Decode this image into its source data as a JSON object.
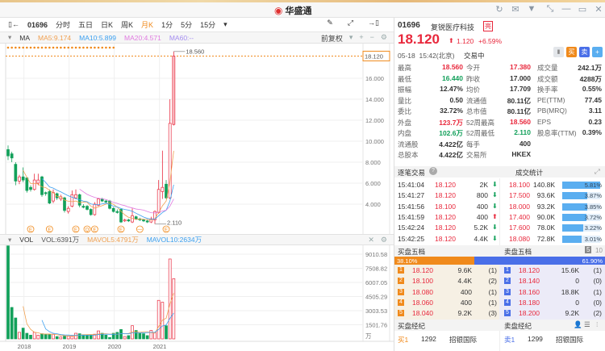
{
  "app": {
    "title": "华盛通",
    "window_icons": [
      "refresh-icon",
      "mail-icon",
      "shirt-icon",
      "shrink-icon",
      "minimize-icon",
      "maximize-icon",
      "close-icon"
    ]
  },
  "toolbar": {
    "code": "01696",
    "tabs": [
      "分时",
      "五日",
      "日K",
      "周K",
      "月K",
      "1分",
      "5分",
      "15分"
    ],
    "active": "月K"
  },
  "ma_row": {
    "label": "MA",
    "ma5": "MA5:9.174",
    "ma10": "MA10:5.899",
    "ma20": "MA20:4.571",
    "ma60": "MA60:--",
    "adjust": "前复权"
  },
  "vol_row": {
    "label": "VOL",
    "vol": "VOL:6391万",
    "mavol5": "MAVOL5:4791万",
    "mavol10": "MAVOL10:2634万"
  },
  "colors": {
    "up": "#e8283c",
    "down": "#12a05a",
    "ma5": "#f0a050",
    "ma10": "#3ba0f0",
    "ma20": "#e07be0",
    "accent": "#f08a1c"
  },
  "chart_data": {
    "type": "candlestick",
    "period": "monthly",
    "start": "2017-09",
    "ohlc": [
      [
        9.2,
        9.6,
        8.2,
        8.6
      ],
      [
        8.8,
        9.0,
        8.0,
        8.4
      ],
      [
        7.8,
        8.0,
        5.8,
        6.2
      ],
      [
        6.2,
        6.8,
        5.9,
        6.6
      ],
      [
        6.6,
        7.5,
        6.1,
        6.3
      ],
      [
        6.5,
        6.6,
        5.1,
        5.3
      ],
      [
        5.6,
        5.8,
        5.2,
        5.4
      ],
      [
        5.4,
        6.9,
        5.3,
        6.3
      ],
      [
        6.0,
        6.9,
        5.8,
        6.3
      ],
      [
        6.6,
        6.7,
        4.7,
        4.9
      ],
      [
        5.1,
        5.2,
        4.8,
        5.0
      ],
      [
        5.2,
        5.4,
        4.0,
        4.1
      ],
      [
        4.3,
        5.4,
        4.1,
        5.1
      ],
      [
        5.0,
        5.1,
        4.4,
        4.6
      ],
      [
        4.5,
        4.9,
        4.3,
        4.7
      ],
      [
        4.6,
        4.7,
        3.2,
        3.4
      ],
      [
        3.3,
        3.8,
        3.1,
        3.6
      ],
      [
        3.8,
        5.3,
        3.7,
        4.9
      ],
      [
        4.6,
        5.4,
        4.5,
        4.9
      ],
      [
        4.9,
        5.0,
        3.7,
        3.9
      ],
      [
        3.8,
        4.0,
        3.6,
        3.7
      ],
      [
        3.8,
        3.9,
        3.4,
        3.5
      ],
      [
        3.5,
        3.6,
        2.9,
        3.0
      ],
      [
        3.0,
        4.2,
        2.9,
        4.0
      ],
      [
        3.9,
        4.6,
        3.8,
        4.5
      ],
      [
        4.5,
        4.6,
        4.2,
        4.3
      ],
      [
        4.3,
        4.4,
        4.1,
        4.2
      ],
      [
        4.3,
        4.4,
        3.5,
        3.6
      ],
      [
        3.6,
        3.7,
        3.2,
        3.3
      ],
      [
        3.3,
        3.5,
        3.1,
        3.2
      ],
      [
        3.5,
        3.6,
        2.2,
        2.3
      ],
      [
        2.4,
        2.6,
        2.3,
        2.5
      ],
      [
        2.5,
        2.6,
        2.3,
        2.4
      ],
      [
        2.3,
        3.6,
        2.2,
        2.9
      ],
      [
        2.8,
        2.9,
        2.5,
        2.6
      ],
      [
        2.6,
        2.7,
        2.4,
        2.5
      ],
      [
        2.5,
        2.6,
        2.3,
        2.4
      ],
      [
        2.4,
        2.5,
        2.2,
        2.3
      ],
      [
        2.3,
        2.8,
        2.2,
        2.6
      ],
      [
        2.5,
        3.4,
        2.11,
        3.3
      ],
      [
        3.2,
        6.3,
        3.1,
        5.4
      ],
      [
        5.2,
        9.1,
        4.5,
        5.6
      ],
      [
        5.9,
        6.3,
        4.5,
        4.6
      ],
      [
        4.6,
        14.0,
        4.5,
        11.7
      ],
      [
        11.6,
        18.56,
        11.5,
        18.12
      ]
    ],
    "volume": [
      9900,
      3350,
      2230,
      700,
      1150,
      600,
      400,
      700,
      400,
      550,
      500,
      450,
      500,
      250,
      200,
      300,
      300,
      300,
      600,
      550,
      450,
      400,
      400,
      500,
      850,
      600,
      400,
      150,
      600,
      700,
      1000,
      250,
      350,
      1400,
      900,
      600,
      550,
      350,
      900,
      700,
      4100,
      3900,
      1400,
      8500,
      6400
    ],
    "price_axis": [
      "16.000",
      "14.000",
      "12.000",
      "10.000",
      "8.000",
      "6.000",
      "4.000"
    ],
    "price_ticks": [
      16,
      14,
      12,
      10,
      8,
      6,
      4
    ],
    "current_price": "18.120",
    "high_label": "18.560",
    "low_label": "2.110",
    "high_value": 18.56,
    "low_value": 2.11,
    "volume_axis": [
      "9010.58",
      "7508.82",
      "6007.05",
      "4505.29",
      "3003.53",
      "1501.76"
    ],
    "volume_ticks": [
      9010.58,
      7508.82,
      6007.05,
      4505.29,
      3003.53,
      1501.76
    ],
    "volume_unit": "万",
    "x_labels": [
      "2018",
      "2019",
      "2020",
      "2021"
    ],
    "x_label_index": [
      4,
      16,
      28,
      40
    ],
    "events": [
      {
        "index": 6,
        "glyph": "E"
      },
      {
        "index": 11,
        "glyph": "E"
      },
      {
        "index": 18,
        "glyph": "E"
      },
      {
        "index": 21,
        "glyph": "Q"
      },
      {
        "index": 23,
        "glyph": "E"
      },
      {
        "index": 30,
        "glyph": "E"
      },
      {
        "index": 35,
        "glyph": "—"
      },
      {
        "index": 42,
        "glyph": "E"
      }
    ]
  },
  "quote": {
    "code": "01696",
    "name": "复锐医疗科技",
    "badge": "亮",
    "price": "18.120",
    "change": "1.120",
    "change_pct": "+6.59%",
    "datetime": "05-18  15:42(北京)",
    "status": "交易中",
    "buttons": [
      "买",
      "卖",
      "+"
    ],
    "stats": [
      [
        [
          "最高",
          "18.560",
          "red"
        ],
        [
          "今开",
          "17.380",
          "red"
        ],
        [
          "成交量",
          "242.1万",
          ""
        ]
      ],
      [
        [
          "最低",
          "16.440",
          "green"
        ],
        [
          "昨收",
          "17.000",
          ""
        ],
        [
          "成交额",
          "4288万",
          ""
        ]
      ],
      [
        [
          "振幅",
          "12.47%",
          ""
        ],
        [
          "均价",
          "17.709",
          ""
        ],
        [
          "换手率",
          "0.55%",
          ""
        ]
      ],
      [
        [
          "量比",
          "0.50",
          ""
        ],
        [
          "流通值",
          "80.11亿",
          ""
        ],
        [
          "PE(TTM)",
          "77.45",
          ""
        ]
      ],
      [
        [
          "委比",
          "32.72%",
          ""
        ],
        [
          "总市值",
          "80.11亿",
          ""
        ],
        [
          "PB(MRQ)",
          "3.11",
          ""
        ]
      ],
      [
        [
          "外盘",
          "123.7万",
          "red"
        ],
        [
          "52周最高",
          "18.560",
          "red"
        ],
        [
          "EPS",
          "0.23",
          ""
        ]
      ],
      [
        [
          "内盘",
          "102.6万",
          "green"
        ],
        [
          "52周最低",
          "2.110",
          "green"
        ],
        [
          "股息率(TTM)",
          "0.39%",
          ""
        ]
      ],
      [
        [
          "流通股",
          "4.422亿",
          ""
        ],
        [
          "每手",
          "400",
          ""
        ],
        [
          "",
          "",
          " "
        ]
      ],
      [
        [
          "总股本",
          "4.422亿",
          ""
        ],
        [
          "交易所",
          "HKEX",
          ""
        ],
        [
          "",
          "",
          " "
        ]
      ]
    ]
  },
  "trades": {
    "title": "逐笔交易",
    "stats_title": "成交统计",
    "rows": [
      [
        "15:41:04",
        "18.120",
        "2K",
        "down"
      ],
      [
        "15:41:27",
        "18.120",
        "800",
        "down"
      ],
      [
        "15:41:56",
        "18.100",
        "400",
        "down"
      ],
      [
        "15:41:59",
        "18.120",
        "400",
        "up"
      ],
      [
        "15:42:24",
        "18.120",
        "5.2K",
        "down"
      ],
      [
        "15:42:25",
        "18.120",
        "4.4K",
        "down"
      ]
    ],
    "stats": [
      [
        "18.100",
        "140.8K",
        "5.81%",
        5.81
      ],
      [
        "17.500",
        "93.6K",
        "3.87%",
        3.87
      ],
      [
        "18.000",
        "93.2K",
        "3.85%",
        3.85
      ],
      [
        "17.400",
        "90.0K",
        "3.72%",
        3.72
      ],
      [
        "17.600",
        "78.0K",
        "3.22%",
        3.22
      ],
      [
        "18.080",
        "72.8K",
        "3.01%",
        3.01
      ]
    ]
  },
  "orderbook": {
    "buy_title": "买盘五档",
    "sell_title": "卖盘五档",
    "depth_5": "5",
    "depth_10": "10",
    "buy_pct": "38.10%",
    "sell_pct": "61.90%",
    "buy_ratio": 38.1,
    "buy": [
      [
        "1",
        "18.120",
        "9.6K",
        "(1)"
      ],
      [
        "2",
        "18.100",
        "4.4K",
        "(2)"
      ],
      [
        "3",
        "18.080",
        "400",
        "(1)"
      ],
      [
        "4",
        "18.060",
        "400",
        "(1)"
      ],
      [
        "5",
        "18.040",
        "9.2K",
        "(3)"
      ]
    ],
    "sell": [
      [
        "1",
        "18.120",
        "15.6K",
        "(1)"
      ],
      [
        "2",
        "18.140",
        "0",
        "(0)"
      ],
      [
        "3",
        "18.160",
        "18.8K",
        "(1)"
      ],
      [
        "4",
        "18.180",
        "0",
        "(0)"
      ],
      [
        "5",
        "18.200",
        "9.2K",
        "(2)"
      ]
    ]
  },
  "brokers": {
    "buy_title": "买盘经纪",
    "sell_title": "卖盘经纪",
    "buy": [
      [
        "买1",
        "1292",
        "招银国际"
      ]
    ],
    "sell": [
      [
        "卖1",
        "1299",
        "招银国际"
      ]
    ]
  }
}
